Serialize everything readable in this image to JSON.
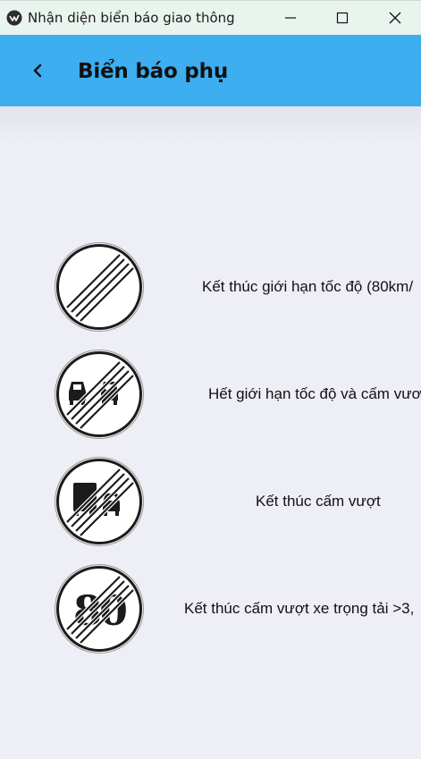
{
  "window": {
    "title": "Nhận diện biển báo giao thông",
    "icon": "app-logo-icon"
  },
  "appbar": {
    "title": "Biển báo phụ",
    "back_icon": "chevron-left-icon",
    "color": "#3daef0"
  },
  "signs": [
    {
      "label": "Kết thúc giới hạn tốc độ (80km/",
      "icon": "end-speed-limit-sign-icon"
    },
    {
      "label": "Hết giới hạn tốc độ và cấm vươ",
      "icon": "end-no-overtaking-cars-sign-icon"
    },
    {
      "label": "Kết thúc cấm vượt",
      "icon": "end-no-overtaking-truck-sign-icon"
    },
    {
      "label": "Kết thúc cấm vượt xe trọng tải >3,",
      "icon": "end-speed-80-sign-icon",
      "sign_text": "80"
    }
  ]
}
